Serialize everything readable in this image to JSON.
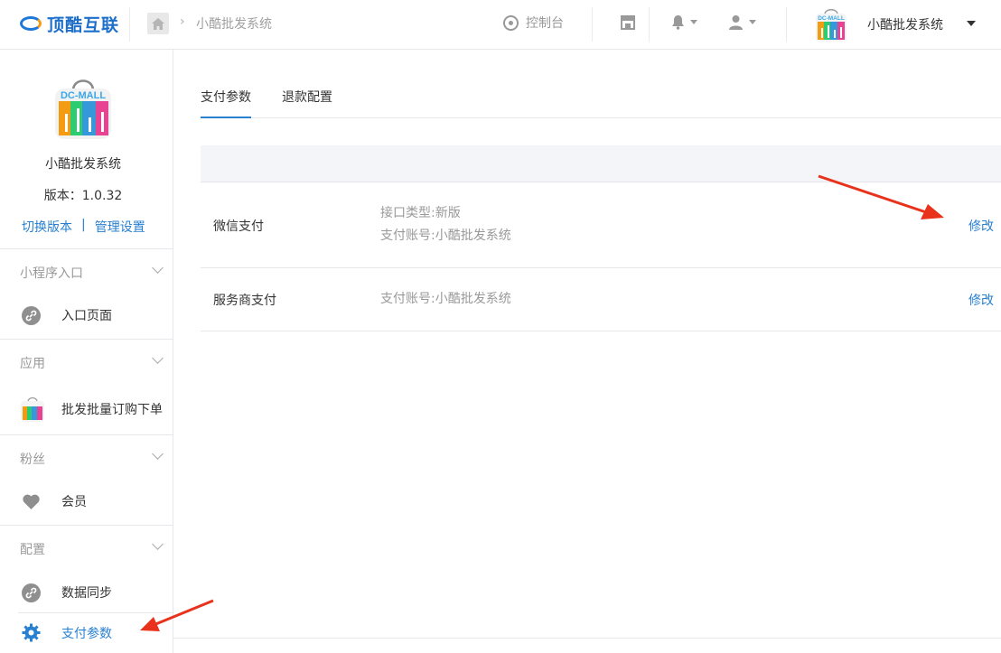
{
  "header": {
    "logo_text": "顶酷互联",
    "breadcrumb": "小酷批发系统",
    "dashboard_label": "控制台",
    "account_name": "小酷批发系统",
    "avatar_text": "DC-MALL"
  },
  "sidebar": {
    "logo_text": "DC-MALL",
    "app_name": "小酷批发系统",
    "version": "版本：1.0.32",
    "switch_version": "切换版本",
    "link_separator": "|",
    "manage_settings": "管理设置",
    "sections": [
      {
        "title": "小程序入口",
        "items": [
          {
            "label": "入口页面",
            "icon": "link-icon"
          }
        ]
      },
      {
        "title": "应用",
        "items": [
          {
            "label": "批发批量订购下单",
            "icon": "app-logo-icon"
          }
        ]
      },
      {
        "title": "粉丝",
        "items": [
          {
            "label": "会员",
            "icon": "heart-icon"
          }
        ]
      },
      {
        "title": "配置",
        "items": [
          {
            "label": "数据同步",
            "icon": "link-icon"
          },
          {
            "label": "支付参数",
            "icon": "gear-icon",
            "active": true
          }
        ]
      }
    ]
  },
  "main": {
    "tabs": [
      {
        "label": "支付参数",
        "active": true
      },
      {
        "label": "退款配置",
        "active": false
      }
    ],
    "rows": [
      {
        "name": "微信支付",
        "info_lines": [
          "接口类型:新版",
          "支付账号:小酷批发系统"
        ],
        "action": "修改"
      },
      {
        "name": "服务商支付",
        "info_lines": [
          "支付账号:小酷批发系统"
        ],
        "action": "修改"
      }
    ]
  },
  "colors": {
    "accent": "#2a80d0",
    "annotation_arrow": "#e8321c",
    "border": "#e7e7eb",
    "table_head_bg": "#f4f5f9"
  }
}
